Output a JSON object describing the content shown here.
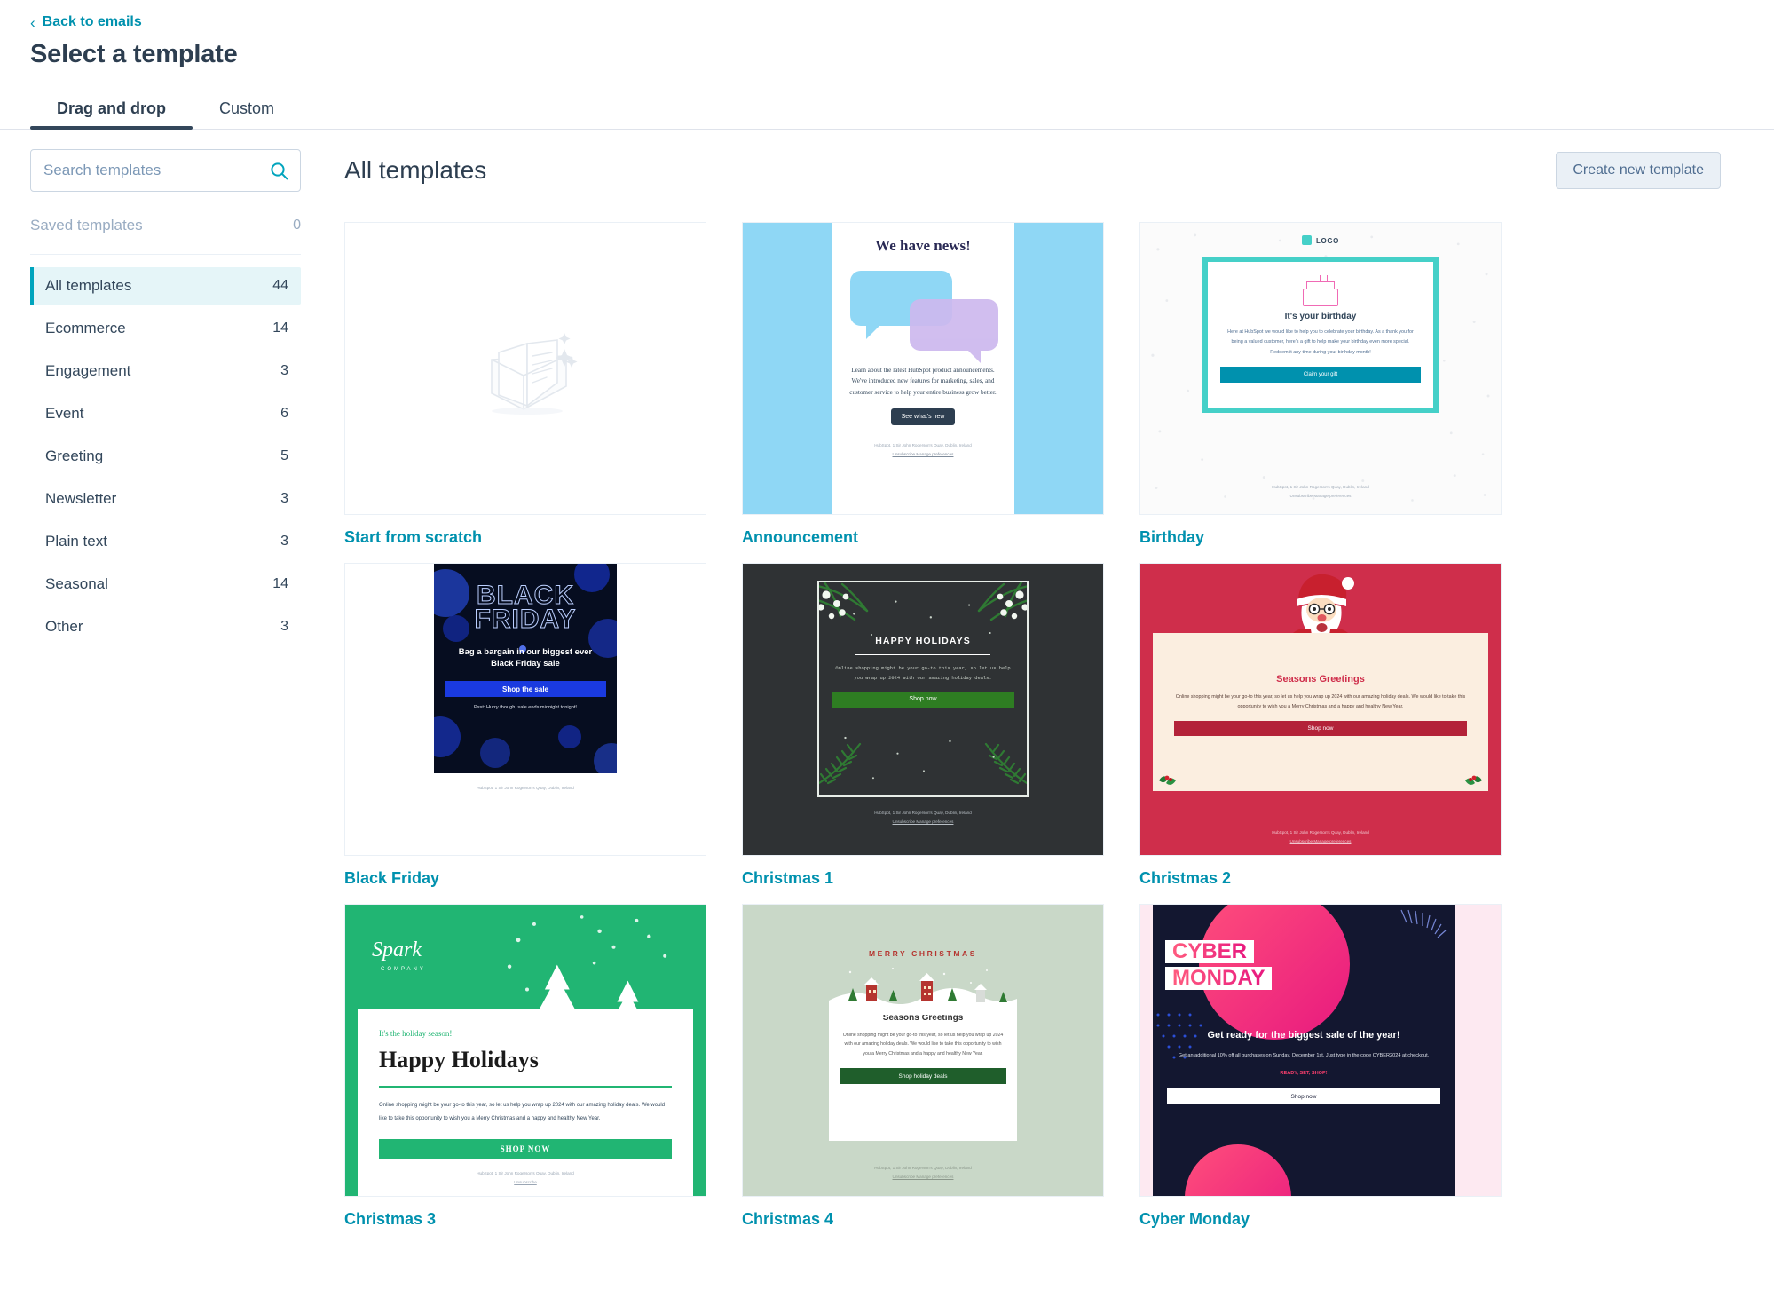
{
  "header": {
    "back_label": "Back to emails",
    "title": "Select a template"
  },
  "tabs": [
    {
      "label": "Drag and drop",
      "active": true
    },
    {
      "label": "Custom",
      "active": false
    }
  ],
  "sidebar": {
    "search": {
      "placeholder": "Search templates",
      "value": "",
      "icon": "search-icon"
    },
    "saved": {
      "label": "Saved templates",
      "count": "0"
    },
    "categories": [
      {
        "label": "All templates",
        "count": "44",
        "active": true
      },
      {
        "label": "Ecommerce",
        "count": "14",
        "active": false
      },
      {
        "label": "Engagement",
        "count": "3",
        "active": false
      },
      {
        "label": "Event",
        "count": "6",
        "active": false
      },
      {
        "label": "Greeting",
        "count": "5",
        "active": false
      },
      {
        "label": "Newsletter",
        "count": "3",
        "active": false
      },
      {
        "label": "Plain text",
        "count": "3",
        "active": false
      },
      {
        "label": "Seasonal",
        "count": "14",
        "active": false
      },
      {
        "label": "Other",
        "count": "3",
        "active": false
      }
    ]
  },
  "main": {
    "title": "All templates",
    "create_button": "Create new template"
  },
  "colors": {
    "link": "#0091ae",
    "accent": "#00a4bd",
    "heading": "#2d3e50",
    "active_bg": "#e5f5f8",
    "announcement_bg": "#8fd7f5",
    "birthday_accent": "#45d0c8",
    "black_friday_bg": "#060d20",
    "black_friday_btn": "#1a3ae0",
    "christmas1_bg": "#2f3234",
    "christmas1_btn": "#2e7d22",
    "christmas2_bg": "#cf2e4b",
    "christmas3_bg": "#21b573",
    "christmas4_bg": "#c9d8c8",
    "cyber_monday_bg": "#131730",
    "cyber_monday_pink": "#e8197f"
  },
  "templates": [
    {
      "name": "Start from scratch",
      "kind": "scratch",
      "thumb": {
        "illustration": "envelope-with-letter-sparkle-icon"
      }
    },
    {
      "name": "Announcement",
      "kind": "announcement",
      "thumb": {
        "heading": "We have news!",
        "body": "Learn about the latest HubSpot product announcements. We've introduced new features for marketing, sales, and customer service to help your entire business grow better.",
        "button": "See what's new",
        "address": "HubSpot, 1 Sir John Rogerson's Quay, Dublin, Ireland",
        "links": "Unsubscribe  Manage preferences"
      }
    },
    {
      "name": "Birthday",
      "kind": "birthday",
      "thumb": {
        "logo": "LOGO",
        "heading": "It's your birthday",
        "body": "Here at HubSpot we would like to help you to celebrate your birthday. As a thank you for being a valued customer, here's a gift to help make your birthday even more special. Redeem it any time during your birthday month!",
        "button": "Claim your gift",
        "address": "HubSpot, 1 Sir John Rogerson's Quay, Dublin, Ireland",
        "links": "Unsubscribe  Manage preferences"
      }
    },
    {
      "name": "Black Friday",
      "kind": "black-friday",
      "thumb": {
        "title_line1": "BLACK",
        "title_line2": "FRIDAY",
        "body": "Bag a bargain in our biggest ever Black Friday sale",
        "button": "Shop the sale",
        "ps": "Psst: Hurry though, sale ends midnight tonight!",
        "address": "HubSpot, 1 Sir John Rogerson's Quay, Dublin, Ireland"
      }
    },
    {
      "name": "Christmas 1",
      "kind": "christmas-1",
      "thumb": {
        "heading": "HAPPY HOLIDAYS",
        "body": "Online shopping might be your go-to this year, so let us help you wrap up 2024 with our amazing holiday deals.",
        "button": "Shop now",
        "address": "HubSpot, 1 Sir John Rogerson's Quay, Dublin, Ireland",
        "links": "Unsubscribe  Manage preferences"
      }
    },
    {
      "name": "Christmas 2",
      "kind": "christmas-2",
      "thumb": {
        "heading": "Seasons Greetings",
        "body": "Online shopping might be your go-to this year, so let us help you wrap up 2024 with our amazing holiday deals. We would like to take this opportunity to wish you a Merry Christmas and a happy and healthy New Year.",
        "button": "Shop now",
        "address": "HubSpot, 1 Sir John Rogerson's Quay, Dublin, Ireland",
        "links": "Unsubscribe  Manage preferences"
      }
    },
    {
      "name": "Christmas 3",
      "kind": "christmas-3",
      "thumb": {
        "logo": "Spark",
        "logo_sub": "COMPANY",
        "kicker": "It's the holiday season!",
        "heading": "Happy Holidays",
        "body": "Online shopping might be your go-to this year, so let us help you wrap up 2024 with our amazing holiday deals. We would like to take this opportunity to wish you a Merry Christmas and a happy and healthy New Year.",
        "button": "SHOP NOW",
        "address": "HubSpot, 1 Sir John Rogerson's Quay, Dublin, Ireland",
        "links": "Unsubscribe"
      }
    },
    {
      "name": "Christmas 4",
      "kind": "christmas-4",
      "thumb": {
        "banner": "MERRY CHRISTMAS",
        "heading": "Seasons Greetings",
        "body": "Online shopping might be your go-to this year, so let us help you wrap up 2024 with our amazing holiday deals. We would like to take this opportunity to wish you a Merry Christmas and a happy and healthy New Year.",
        "button": "Shop holiday deals",
        "address": "HubSpot, 1 Sir John Rogerson's Quay, Dublin, Ireland",
        "links": "Unsubscribe  Manage preferences"
      }
    },
    {
      "name": "Cyber Monday",
      "kind": "cyber-monday",
      "thumb": {
        "title_line1": "CYBER",
        "title_line2": "MONDAY",
        "heading": "Get ready for the biggest sale of the year!",
        "body": "Get an additional 10% off all purchases on Sunday, December 1st. Just type in the code CYBER2024 at checkout.",
        "cta_text": "READY, SET, SHOP!",
        "button": "Shop now"
      }
    }
  ]
}
